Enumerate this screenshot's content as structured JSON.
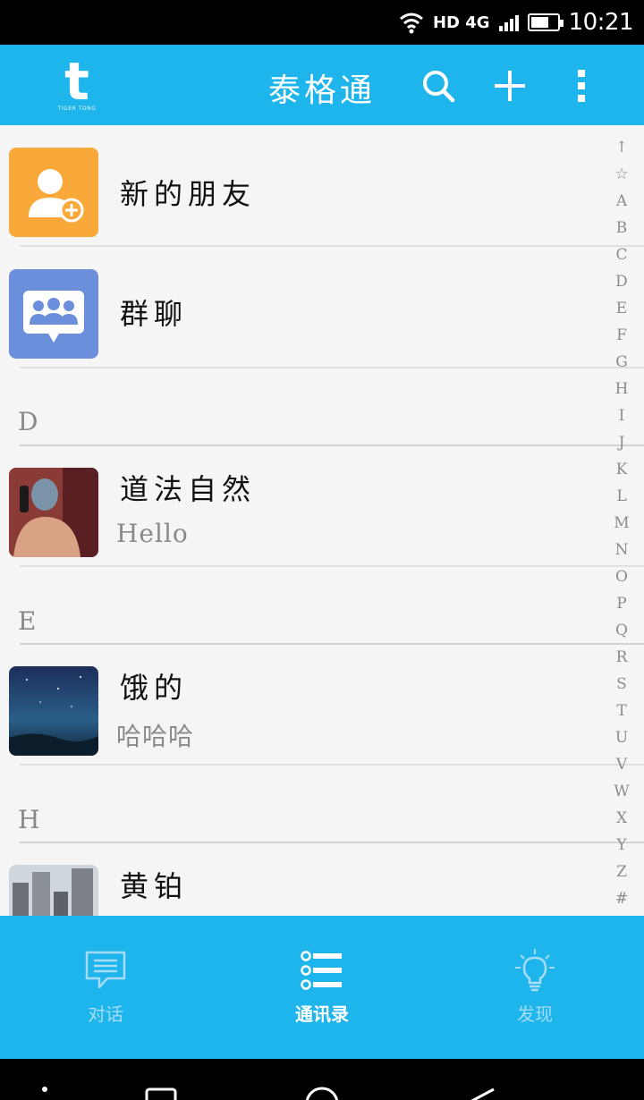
{
  "status_bar": {
    "network": "HD 4G",
    "time": "10:21"
  },
  "app_bar": {
    "logo_letter": "t",
    "logo_subtext": "TIGER TONG",
    "title": "泰格通",
    "icons": [
      "search-icon",
      "plus-icon",
      "more-vertical-icon"
    ]
  },
  "contacts": {
    "new_friends_label": "新的朋友",
    "group_chat_label": "群聊",
    "sections": [
      {
        "letter": "D",
        "items": [
          {
            "name": "道法自然",
            "message": "Hello"
          }
        ]
      },
      {
        "letter": "E",
        "items": [
          {
            "name": "饿的",
            "message": "哈哈哈"
          }
        ]
      },
      {
        "letter": "H",
        "items": [
          {
            "name": "黄铂",
            "message": ""
          }
        ]
      }
    ]
  },
  "alphabet_index": [
    "↑",
    "☆",
    "A",
    "B",
    "C",
    "D",
    "E",
    "F",
    "G",
    "H",
    "I",
    "J",
    "K",
    "L",
    "M",
    "N",
    "O",
    "P",
    "Q",
    "R",
    "S",
    "T",
    "U",
    "V",
    "W",
    "X",
    "Y",
    "Z",
    "#"
  ],
  "bottom_nav": {
    "tabs": [
      {
        "label": "对话",
        "icon": "chat-bubble-icon",
        "active": false
      },
      {
        "label": "通讯录",
        "icon": "contacts-list-icon",
        "active": true
      },
      {
        "label": "发现",
        "icon": "lightbulb-icon",
        "active": false
      }
    ]
  },
  "colors": {
    "primary": "#1eb4ec",
    "new_friend_tile": "#f9a93a",
    "group_tile": "#6b8fdb",
    "tab_inactive": "#a6dcf5"
  }
}
